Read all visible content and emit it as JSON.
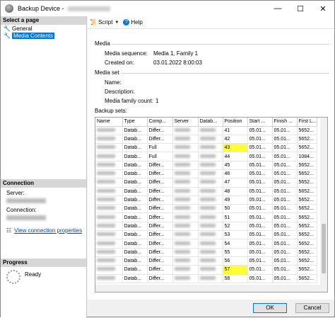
{
  "window": {
    "title": "Backup Device - ",
    "controls": [
      "—",
      "☐",
      "✕"
    ]
  },
  "left": {
    "select_page": "Select a page",
    "pages": [
      {
        "label": "General",
        "icon": "wrench-icon"
      },
      {
        "label": "Media Contents",
        "icon": "wrench-icon"
      }
    ],
    "connection": {
      "title": "Connection",
      "server_label": "Server:",
      "connection_label": "Connection:",
      "link": "View connection properties"
    },
    "progress": {
      "title": "Progress",
      "status": "Ready"
    }
  },
  "toolbar": {
    "script": "Script",
    "help": "Help"
  },
  "media": {
    "section": "Media",
    "sequence_label": "Media sequence:",
    "sequence_value": "Media 1, Family 1",
    "created_label": "Created on:",
    "created_value": "03.01.2022 8:00:03"
  },
  "media_set": {
    "section": "Media set",
    "name_label": "Name:",
    "description_label": "Description:",
    "family_count_label": "Media family count:",
    "family_count_value": "1"
  },
  "backup_sets": {
    "label": "Backup sets:",
    "columns": [
      "Name",
      "Type",
      "Comp...",
      "Server",
      "Datab...",
      "Position",
      "Start ...",
      "Finish ...",
      "First L..."
    ],
    "rows": [
      {
        "type": "Datab...",
        "comp": "Differ...",
        "position": "41",
        "start": "05.01...",
        "finish": "05.01...",
        "first": "5652...",
        "hl": false
      },
      {
        "type": "Datab...",
        "comp": "Differ...",
        "position": "42",
        "start": "05.01...",
        "finish": "05.01...",
        "first": "5652...",
        "hl": false
      },
      {
        "type": "Datab...",
        "comp": "Full",
        "position": "43",
        "start": "05.01...",
        "finish": "05.01...",
        "first": "5652...",
        "hl": true
      },
      {
        "type": "Datab...",
        "comp": "Full",
        "position": "44",
        "start": "05.01...",
        "finish": "05.01...",
        "first": "1084...",
        "hl": false
      },
      {
        "type": "Datab...",
        "comp": "Differ...",
        "position": "45",
        "start": "05.01...",
        "finish": "05.01...",
        "first": "5652...",
        "hl": false
      },
      {
        "type": "Datab...",
        "comp": "Differ...",
        "position": "46",
        "start": "05.01...",
        "finish": "05.01...",
        "first": "5652...",
        "hl": false
      },
      {
        "type": "Datab...",
        "comp": "Differ...",
        "position": "47",
        "start": "05.01...",
        "finish": "05.01...",
        "first": "5652...",
        "hl": false
      },
      {
        "type": "Datab...",
        "comp": "Differ...",
        "position": "48",
        "start": "05.01...",
        "finish": "05.01...",
        "first": "5652...",
        "hl": false
      },
      {
        "type": "Datab...",
        "comp": "Differ...",
        "position": "49",
        "start": "05.01...",
        "finish": "05.01...",
        "first": "5652...",
        "hl": false
      },
      {
        "type": "Datab...",
        "comp": "Differ...",
        "position": "50",
        "start": "05.01...",
        "finish": "05.01...",
        "first": "5652...",
        "hl": false
      },
      {
        "type": "Datab...",
        "comp": "Differ...",
        "position": "51",
        "start": "05.01...",
        "finish": "05.01...",
        "first": "5652...",
        "hl": false
      },
      {
        "type": "Datab...",
        "comp": "Differ...",
        "position": "52",
        "start": "05.01...",
        "finish": "05.01...",
        "first": "5652...",
        "hl": false
      },
      {
        "type": "Datab...",
        "comp": "Differ...",
        "position": "53",
        "start": "05.01...",
        "finish": "05.01...",
        "first": "5652...",
        "hl": false
      },
      {
        "type": "Datab...",
        "comp": "Differ...",
        "position": "54",
        "start": "05.01...",
        "finish": "05.01...",
        "first": "5652...",
        "hl": false
      },
      {
        "type": "Datab...",
        "comp": "Differ...",
        "position": "55",
        "start": "05.01...",
        "finish": "05.01...",
        "first": "5652...",
        "hl": false
      },
      {
        "type": "Datab...",
        "comp": "Differ...",
        "position": "56",
        "start": "05.01...",
        "finish": "05.01...",
        "first": "5652...",
        "hl": false
      },
      {
        "type": "Datab...",
        "comp": "Differ...",
        "position": "57",
        "start": "05.01...",
        "finish": "05.01...",
        "first": "5652...",
        "hl": true
      },
      {
        "type": "Datab...",
        "comp": "Differ...",
        "position": "58",
        "start": "05.01...",
        "finish": "05.01...",
        "first": "5652...",
        "hl": false
      }
    ]
  },
  "buttons": {
    "ok": "OK",
    "cancel": "Cancel"
  },
  "colors": {
    "highlight": "#ffff33",
    "accent": "#0078d7"
  }
}
